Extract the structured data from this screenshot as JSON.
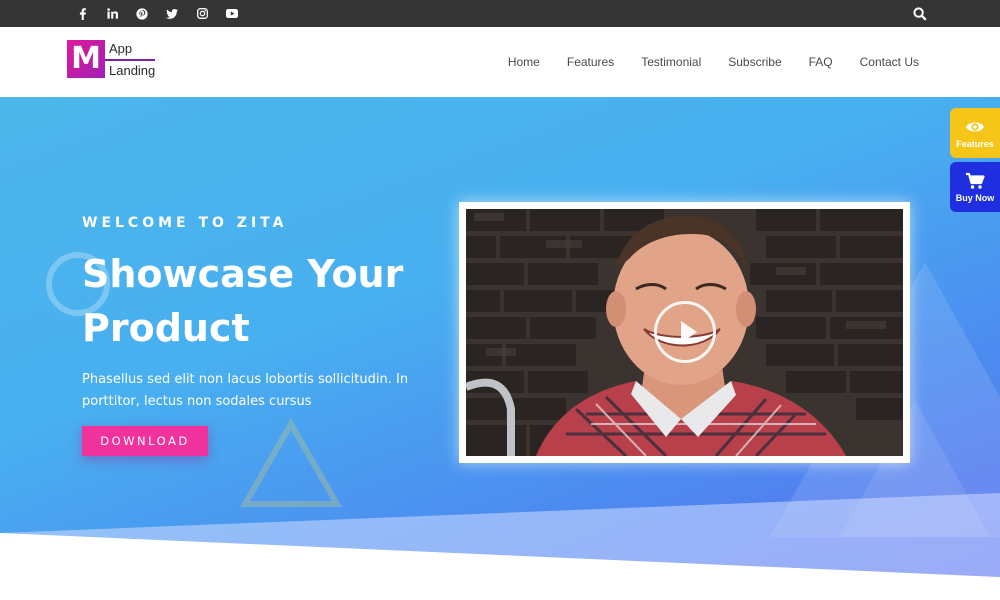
{
  "topbar": {
    "social_icons": [
      "facebook-icon",
      "linkedin-icon",
      "pinterest-icon",
      "twitter-icon",
      "instagram-icon",
      "youtube-icon"
    ],
    "search_icon": "search-icon"
  },
  "logo": {
    "letter": "M",
    "line1": "App",
    "line2": "Landing"
  },
  "nav": [
    "Home",
    "Features",
    "Testimonial",
    "Subscribe",
    "FAQ",
    "Contact Us"
  ],
  "hero": {
    "eyebrow": "WELCOME TO ZITA",
    "title": "Showcase Your Product",
    "description": "Phasellus sed elit non lacus lobortis sollicitudin. In porttitor, lectus non sodales cursus",
    "button": "DOWNLOAD"
  },
  "video": {
    "play_icon": "play-icon"
  },
  "side_widgets": {
    "features": {
      "label": "Features",
      "icon": "eye-icon",
      "color": "#f5c518"
    },
    "buy_now": {
      "label": "Buy Now",
      "icon": "cart-icon",
      "color": "#1f2fe0"
    }
  },
  "colors": {
    "topbar": "#353535",
    "hero_start": "#4db6ea",
    "hero_end": "#5b6cef",
    "accent": "#f0339c"
  }
}
